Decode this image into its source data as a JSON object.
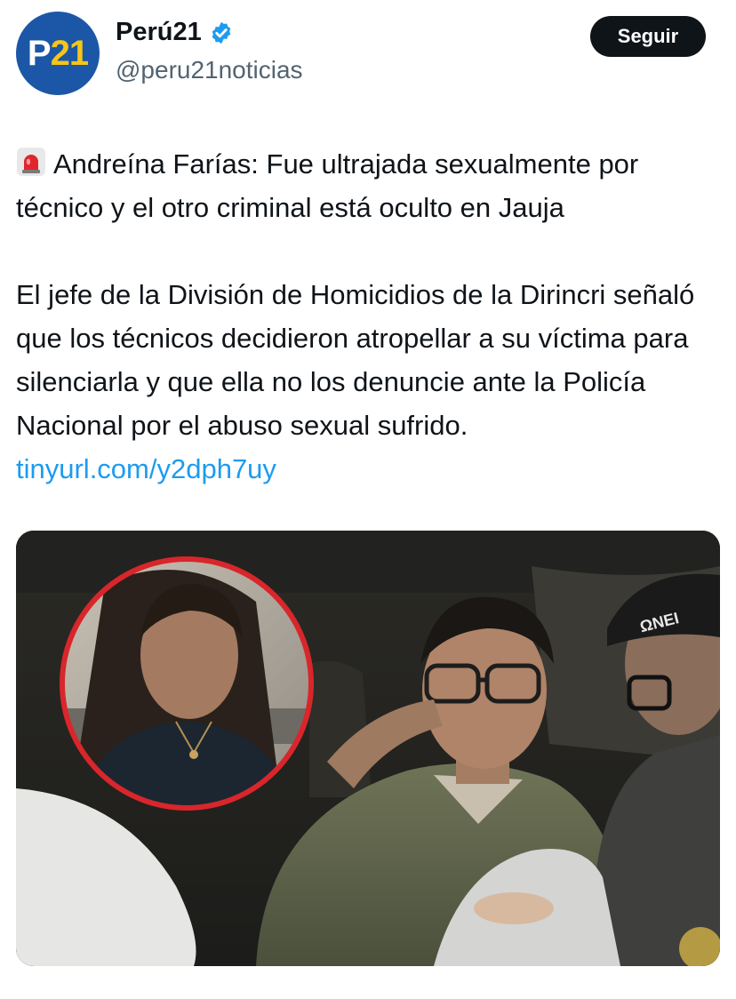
{
  "account": {
    "avatar_text_p": "P",
    "avatar_text_21": "21",
    "display_name": "Perú21",
    "handle": "@peru21noticias",
    "follow_label": "Seguir"
  },
  "tweet": {
    "headline": "Andreína Farías: Fue ultrajada sexualmente por técnico y el otro criminal está oculto en Jauja",
    "body": "El jefe de la División de Homicidios de la Dirincri señaló que los técnicos decidieron atropellar a su víctima para silenciarla y que ella no los denuncie ante la Policía Nacional por el abuso sexual sufrido.",
    "link": "tinyurl.com/y2dph7uy"
  },
  "media": {
    "cap_text": "ΩNEI"
  },
  "colors": {
    "link": "#1d9bf0",
    "avatar_bg": "#1b57a6",
    "avatar_accent": "#f5c518",
    "verified": "#1d9bf0",
    "inset_ring": "#d8262b"
  }
}
